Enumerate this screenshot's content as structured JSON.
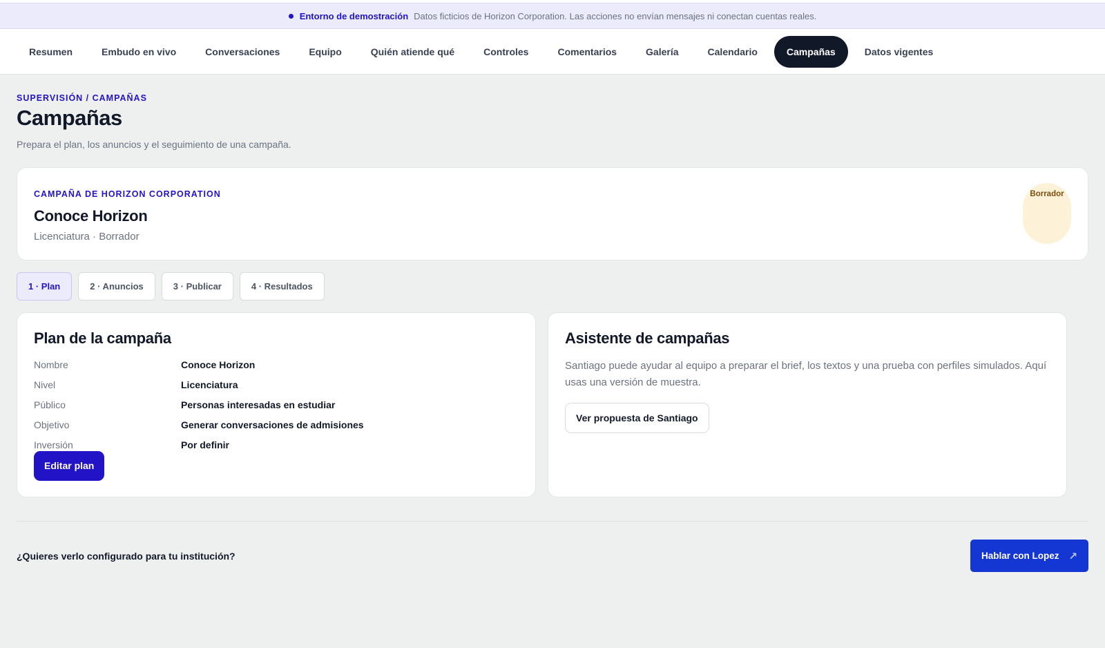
{
  "demo_banner": {
    "title": "Entorno de demostración",
    "text": "Datos ficticios de Horizon Corporation. Las acciones no envían mensajes ni conectan cuentas reales."
  },
  "nav": {
    "items": [
      {
        "label": "Resumen"
      },
      {
        "label": "Embudo en vivo"
      },
      {
        "label": "Conversaciones"
      },
      {
        "label": "Equipo"
      },
      {
        "label": "Quién atiende qué"
      },
      {
        "label": "Controles"
      },
      {
        "label": "Comentarios"
      },
      {
        "label": "Galería"
      },
      {
        "label": "Calendario"
      },
      {
        "label": "Campañas"
      },
      {
        "label": "Datos vigentes"
      }
    ],
    "active": "Campañas"
  },
  "page": {
    "eyebrow": "Supervisión / Campañas",
    "title": "Campañas",
    "subtitle": "Prepara el plan, los anuncios y el seguimiento de una campaña."
  },
  "campaign": {
    "eyebrow": "Campaña de Horizon Corporation",
    "title": "Conoce Horizon",
    "meta": "Licenciatura · Borrador",
    "status": "Borrador"
  },
  "steps": [
    {
      "label": "1 · Plan"
    },
    {
      "label": "2 · Anuncios"
    },
    {
      "label": "3 · Publicar"
    },
    {
      "label": "4 · Resultados"
    }
  ],
  "plan": {
    "title": "Plan de la campaña",
    "rows": [
      {
        "label": "Nombre",
        "value": "Conoce Horizon"
      },
      {
        "label": "Nivel",
        "value": "Licenciatura"
      },
      {
        "label": "Público",
        "value": "Personas interesadas en estudiar"
      },
      {
        "label": "Objetivo",
        "value": "Generar conversaciones de admisiones"
      },
      {
        "label": "Inversión",
        "value": "Por definir"
      }
    ],
    "edit_label": "Editar plan"
  },
  "assistant": {
    "title": "Asistente de campañas",
    "text": "Santiago puede ayudar al equipo a preparar el brief, los textos y una prueba con perfiles simulados. Aquí usas una versión de muestra.",
    "button_label": "Ver propuesta de Santiago"
  },
  "footer": {
    "question": "¿Quieres verlo configurado para tu institución?",
    "cta_label": "Hablar con Lopez",
    "cta_icon": "↗"
  },
  "colors": {
    "accent": "#2313c7",
    "cta": "#1436d3",
    "nav_active": "#111827",
    "badge_bg": "#fdf1d8"
  }
}
